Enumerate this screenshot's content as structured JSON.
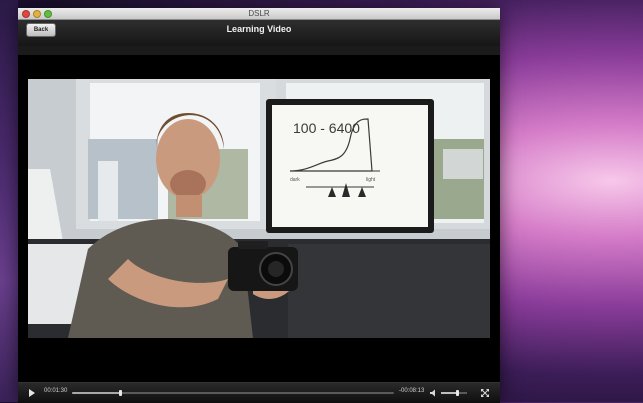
{
  "window": {
    "title": "DSLR"
  },
  "toolbar": {
    "back_label": "Back",
    "title": "Learning Video"
  },
  "video": {
    "whiteboard_text": "100 - 6400",
    "whiteboard_labels": [
      "dark",
      "light"
    ]
  },
  "controls": {
    "elapsed": "00:01:30",
    "remaining": "-00:08:13",
    "progress": 0.15,
    "volume": 0.6
  },
  "icons": {
    "play": "play-icon",
    "volume": "speaker-icon",
    "fullscreen": "expand-icon"
  }
}
